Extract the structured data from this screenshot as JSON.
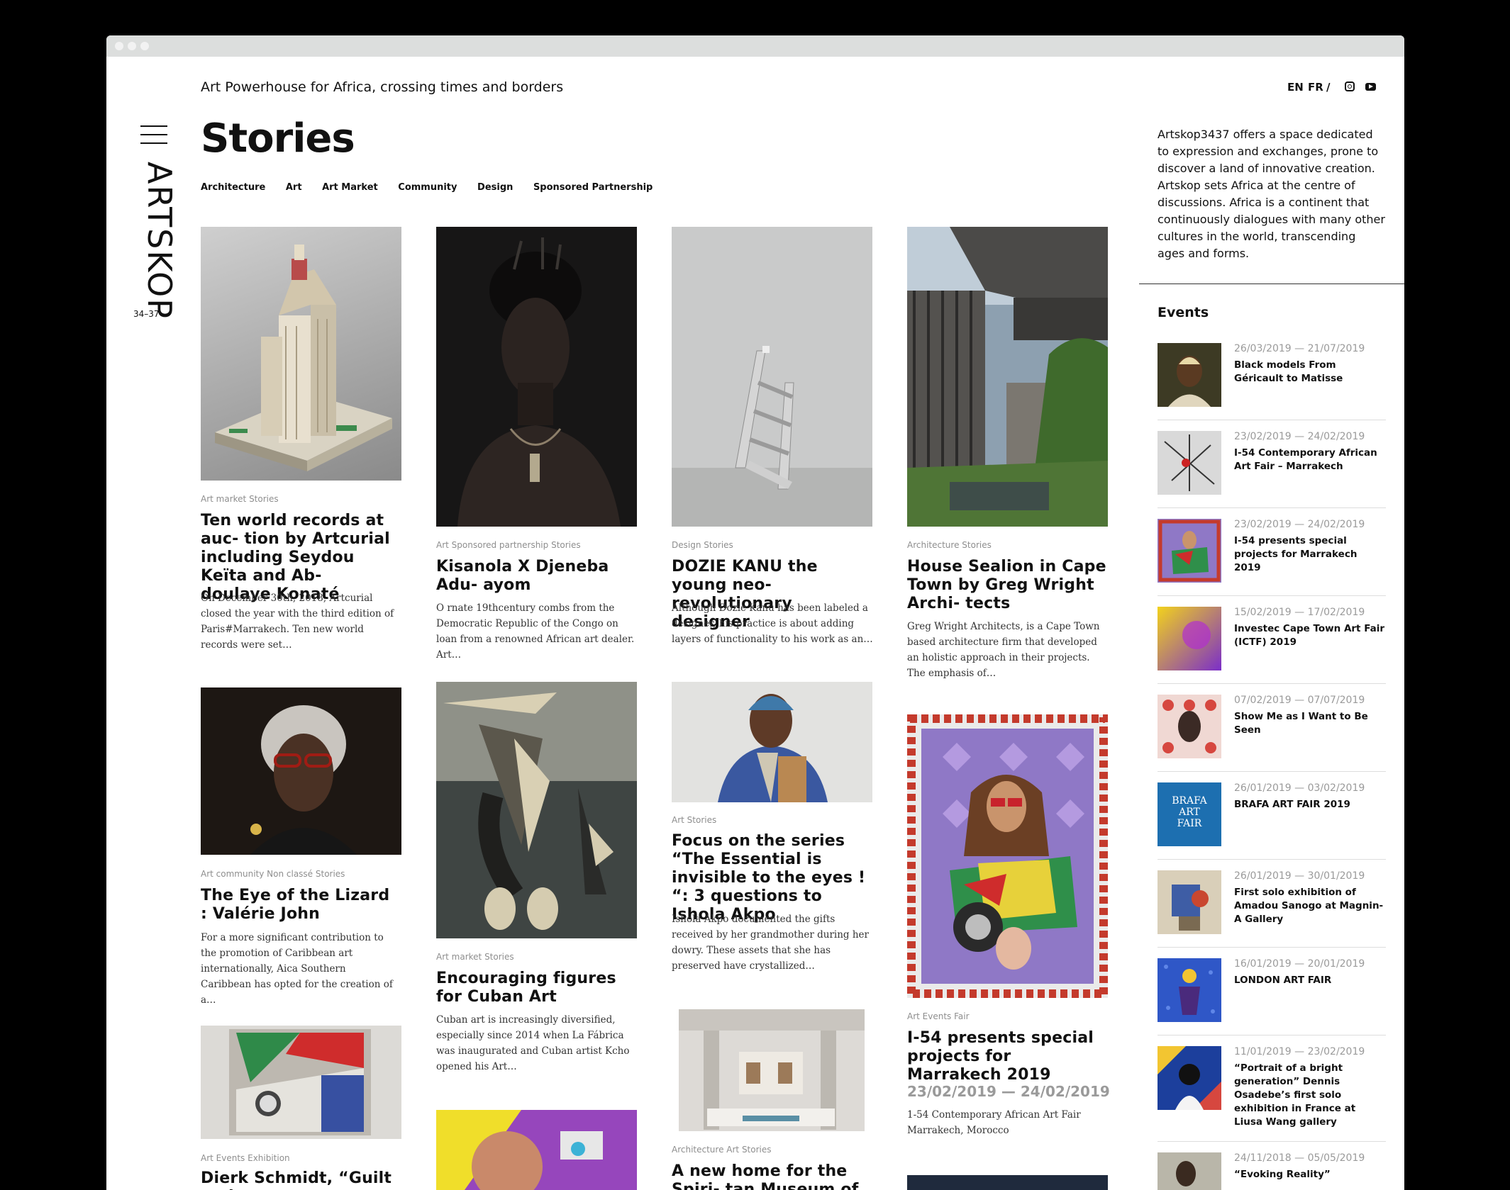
{
  "tagline": "Art Powerhouse for Africa, crossing times and borders",
  "lang": {
    "en": "EN",
    "fr": "FR",
    "slash": "/"
  },
  "logo": {
    "word": "ARTSKOP",
    "number": "34–37"
  },
  "page_title": "Stories",
  "categories": [
    "Architecture",
    "Art",
    "Art Market",
    "Community",
    "Design",
    "Sponsored Partnership"
  ],
  "cards": [
    {
      "meta": "Art market Stories",
      "title": "Ten world records at auc- tion by Artcurial including Seydou Keïta and Ab- doulaye Konaté",
      "excerpt": "On December 30th, 2018, Artcurial closed the year with the third edition of Paris#Marrakech. Ten new world records were set…"
    },
    {
      "meta": "Art Sponsored partnership Stories",
      "title": "Kisanola X Djeneba Adu- ayom",
      "excerpt": "O rnate 19thcentury combs from the Democratic Republic of the Congo on loan from a renowned African art dealer. Art…"
    },
    {
      "meta": "Design Stories",
      "title": "DOZIE KANU the young neo-revolutionary designer",
      "excerpt": "Although Dozie Kanu has been labeled a designer, his practice is about adding layers of functionality to his work as an…"
    },
    {
      "meta": "Architecture Stories",
      "title": "House Sealion in Cape Town by Greg Wright Archi- tects",
      "excerpt": "Greg Wright Architects,  is a Cape Town based architecture firm that developed an holistic approach in their projects.  The emphasis of…"
    },
    {
      "meta": "Art community Non classé Stories",
      "title": "The Eye of the Lizard : Valérie John",
      "excerpt": "For a more significant contribution to the promotion of Caribbean art internationally, Aica Southern Caribbean has opted for the creation of a…"
    },
    {
      "meta": "Art market Stories",
      "title": "Encouraging figures for Cuban Art",
      "excerpt": "Cuban art is increasingly diversified, especially since 2014 when La Fábrica was inaugurated and Cuban artist Kcho opened his Art…"
    },
    {
      "meta": "Art Stories",
      "title": "Focus on the series “The Essential is invisible to the eyes ! “: 3 questions to Ishola Akpo",
      "excerpt": "Ishola Akpo documented the gifts received by her grandmother during her dowry. These assets that she has preserved have crystallized…"
    },
    {
      "meta": "Art Events Fair",
      "title": "I-54 presents special projects for Marrakech 2019",
      "date": "23/02/2019 — 24/02/2019",
      "excerpt": "1-54 Contemporary African Art Fair Marrakech, Morocco"
    },
    {
      "meta": "Art Events Exhibition",
      "title": "Dierk Schmidt, “Guilt and"
    },
    {
      "meta": "Architecture Art Stories",
      "title": "A new home for the Spiri- tan Museum of classical"
    }
  ],
  "about": "Artskop3437 offers a space dedicated to expression and exchanges, prone to discover a land of innovative creation. Artskop sets Africa at the centre of discussions. Africa is a continent that continuously dialogues with many other cultures in the world, transcending ages and forms.",
  "events_heading": "Events",
  "events": [
    {
      "date": "26/03/2019 — 21/07/2019",
      "title": "Black models From Géricault to Matisse"
    },
    {
      "date": "23/02/2019 — 24/02/2019",
      "title": "I-54 Contemporary African Art Fair – Marrakech"
    },
    {
      "date": "23/02/2019 — 24/02/2019",
      "title": "I-54 presents special projects for Marrakech 2019"
    },
    {
      "date": "15/02/2019 — 17/02/2019",
      "title": "Investec Cape Town Art Fair (ICTF) 2019"
    },
    {
      "date": "07/02/2019 — 07/07/2019",
      "title": "Show Me as I Want to Be Seen"
    },
    {
      "date": "26/01/2019 — 03/02/2019",
      "title": "BRAFA ART FAIR 2019",
      "thumb_text": "BRAFA ART FAIR"
    },
    {
      "date": "26/01/2019 — 30/01/2019",
      "title": "First solo exhibition of Amadou Sanogo at Magnin-A Gallery"
    },
    {
      "date": "16/01/2019 — 20/01/2019",
      "title": "LONDON ART FAIR"
    },
    {
      "date": "11/01/2019 — 23/02/2019",
      "title": "“Portrait of a bright generation” Dennis Osadebe’s first solo exhibition in France at Liusa Wang gallery"
    },
    {
      "date": "24/11/2018 — 05/05/2019",
      "title": "“Evoking Reality”"
    }
  ],
  "colors": {
    "accent": "#111111",
    "meta_gray": "#8e8e8e",
    "frame_bar": "#dcdedd"
  }
}
